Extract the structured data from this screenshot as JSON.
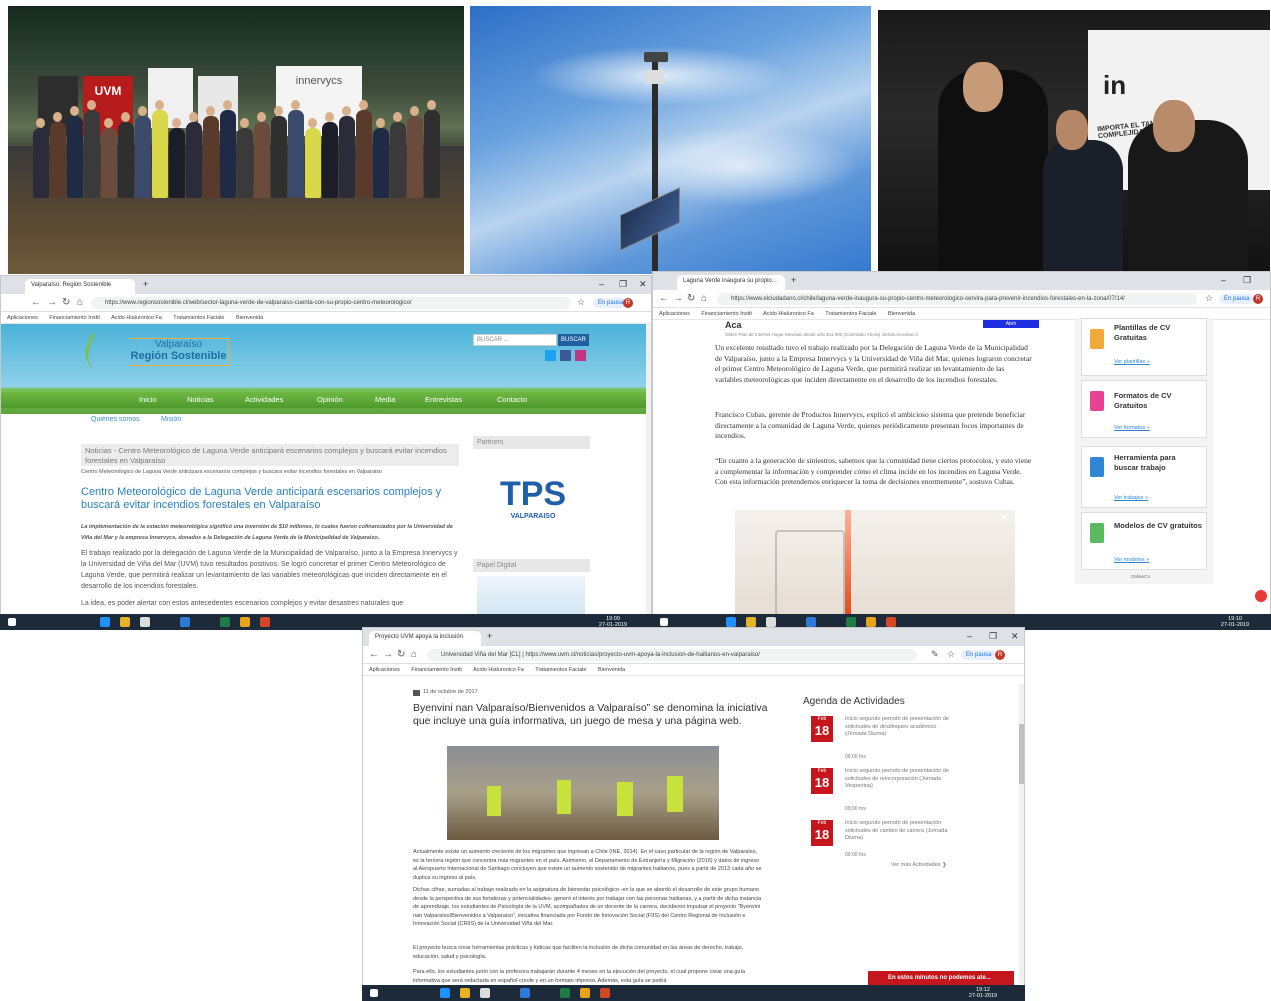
{
  "winA": {
    "tab": "Valparaíso: Región Sostenible",
    "url": "https://www.regionsostenible.cl/web/sector-laguna-verde-de-valparaiso-cuenta-con-su-propio-centro-meteorologico/",
    "pausa": "En pausa",
    "avatar": "R",
    "bookmarks": [
      "Aplicaciones",
      "Financiamiento Instit",
      "Acido Hialuronico Fa",
      "Tratamientos Faciale",
      "Bienvenida"
    ],
    "logo_line1": "Valparaíso",
    "logo_line2": "Región Sostenible",
    "search_placeholder": "BUSCAR ...",
    "search_button": "BUSCAR",
    "menu": [
      "Inicio",
      "Noticias",
      "Actividades",
      "Opinión",
      "Media",
      "Entrevistas",
      "Contacto"
    ],
    "submenu": [
      "Quiénes somos",
      "Misión"
    ],
    "breadcrumb": "Noticias - Centro Meteorológico de Laguna Verde anticipará escenarios complejos y buscará evitar incendios forestales en Valparaíso",
    "img_alt": "Centro Meteorologico de Laguna Verde anticipara escenarios complejos y buscara evitar incendios forestales en Valparaiso",
    "headline": "Centro Meteorológico de Laguna Verde anticipará escenarios complejos y buscará evitar incendios forestales en Valparaíso",
    "lead": "La implementación de la estación meteorológica significó una inversión de $10 millones, lo cuales fueron cofinanciados por la Universidad de Viña del Mar y la empresa Innervycs, donados a la Delegación de Laguna Verde de la Municipalidad de Valparaíso.",
    "body1": "El trabajo realizado por la delegación de Laguna Verde de la Municipalidad de Valparaíso, junto a la Empresa Innervycs y la Universidad de Viña del Mar (UVM) tuvo resultados positivos. Se logró concretar el primer Centro Meteorológico de Laguna Verde, que permitirá realizar un levantamiento de las variables meteorológicas que inciden directamente en el desarrollo de los incendios forestales.",
    "body2": "La idea, es poder alertar con estos antecedentes escenarios complejos y evitar desastres naturales que",
    "partners": "Partners",
    "tps": "TPS",
    "tps_sub": "VALPARAÍSO",
    "papel": "Papel Digital",
    "time": "19:09",
    "date": "27-01-2019"
  },
  "winB": {
    "tab": "Laguna Verde inaugura su propio...",
    "url": "https://www.elciudadano.cl/chile/laguna-verde-inaugura-su-propio-centro-meteorologico-servira-para-prevenir-incendios-forestales-en-la-zona/07/14/",
    "pausa": "En pausa",
    "avatar": "R",
    "bookmarks": [
      "Aplicaciones",
      "Financiamiento Instit",
      "Acido Hialuronico Fa",
      "Tratamientos Faciale",
      "Bienvenida"
    ],
    "ad_title": "Aca",
    "ad_text": "Obtén Plan de Internet Hogar Movistar desde sólo $11.990 (Contrátalo Ahora) ofertas.movistar.cl",
    "ad_button": "Abrir",
    "para1": "Un excelente resultado tuvo el trabajo realizado por la Delegación de Laguna Verde de la Municipalidad de Valparaíso, junto a la Empresa Innervycs y la Universidad de Viña del Mar, quienes lograron concretar el primer Centro Meteorológico de Laguna Verde, que permitirá realizar un levantamiento de las variables meteorológicas que inciden directamente en el desarrollo de los incendios forestales.",
    "para2": "Francisco Cubas, gerente de Productos Innervycs, explicó el ambicioso sistema que pretende beneficiar directamente a la comunidad de Laguna Verde, quienes periódicamente presentan focos importantes de incendios.",
    "para3": "“En cuanto a la generación de siniestros, sabemos que la comunidad tiene ciertos protocolos, y esto viene a complementar la información y comprender cómo el clima incide en los incendios en Laguna Verde. Con esta información pretendemos enriquecer la toma de decisiones enormemente”, sostuvo Cubas.",
    "cv": [
      {
        "title": "Plantillas de CV Gratuitas",
        "link": "Ver plantillas »",
        "color": "#f0a93b"
      },
      {
        "title": "Formatos de CV Gratuitos",
        "link": "Ver formatos »",
        "color": "#e84393"
      },
      {
        "title": "Herramienta para buscar trabajo",
        "link": "Ver trabajos »",
        "color": "#2f86d6"
      },
      {
        "title": "Modelos de CV gratuitos",
        "link": "Ver modelos »",
        "color": "#5cb85c"
      }
    ],
    "cv_footer": "OnlineCV",
    "time": "19:10",
    "date": "27-01-2019"
  },
  "winC": {
    "tab": "Proyecto UVM apoya la inclusión",
    "site": "Universidad Viña del Mar [CL]",
    "url": "https://www.uvm.cl/noticias/proyecto-uvm-apoya-la-inclusion-de-haitianos-en-valparaiso/",
    "pausa": "En pausa",
    "avatar": "R",
    "bookmarks": [
      "Aplicaciones",
      "Financiamiento Instit",
      "Acido Hialuronico Fa",
      "Tratamientos Faciale",
      "Bienvenida"
    ],
    "date_line": "11 de octubre de 2017",
    "headline": "Byenvini nan Valparaíso/Bienvenidos a Valparaíso” se denomina la iniciativa que incluye una guía informativa, un juego de mesa y una página web.",
    "p1": "Actualmente existe un aumento creciente de los migrantes que ingresan a Chile (INE, 2014). En el caso particular de la región de Valparaíso, es la tercera región que concentra más migrantes en el país. Asimismo, el Departamento de Extranjería y Migración (2016) y datos de ingreso al Aeropuerto Internacional de Santiago concluyen que existe un aumento sostenido de migrantes haitianos, pues a partir de 2013 cada año se duplica su ingreso al país.",
    "p2": "Dichas cifras, sumadas al trabajo realizado en la asignatura de bienestar psicológico -en la que se abordó el desarrollo de este grupo humano desde la perspectiva de sus fortalezas y potencialidades- generó el interés por trabajar con las personas haitianas, y a partir de dicha instancia de aprendizaje, los estudiantes de Psicología de la UVM, acompañados de un docente de la carrera, decidieron impulsar el proyecto “Byenvini nan Valparaíso/Bienvenidos a Valparaíso”, iniciativa financiada por Fondo de Innovación Social (FIIS) del Centro Regional de Inclusión e Innovación Social (CRIIS) de la Universidad Viña del Mar.",
    "p3": "El proyecto busca crear herramientas prácticas y lúdicas que faciliten la inclusión de dicha comunidad en las áreas de derecho, trabajo, educación, salud y psicología.",
    "p4": "Para ello, los estudiantes junto con la profesora trabajarán durante 4 meses en la ejecución del proyecto, el cual propone crear una guía informativa que será redactada en español-creole y en un formato impreso. Además, esta guía se podrá",
    "agenda_title": "Agenda de Actividades",
    "events": [
      {
        "month": "Feb",
        "day": "18",
        "text": "Inicio segundo período de presentación de solicitudes de desbloqueo académico (Jornada Diurna)",
        "time": "09:00 hrs"
      },
      {
        "month": "Feb",
        "day": "18",
        "text": "Inicio segundo período de presentación de solicitudes de reincorporación (Jornada Vespertina)",
        "time": "09:00 hrs"
      },
      {
        "month": "Feb",
        "day": "18",
        "text": "Inicio segundo período de presentación solicitudes de cambio de carrera (Jornada Diurna)",
        "time": "09:00 hrs"
      }
    ],
    "more": "Ver más Actividades",
    "chat": "En estos minutos no podemos ate...",
    "time": "19:12",
    "date": "27-01-2019"
  },
  "photo1": {
    "banner1": "UVM",
    "banner2": "innervycs"
  },
  "photo3": {
    "banner": "in",
    "slogan": "IMPORTA EL TAMAÑ LA COMPLEJIDAD DEL DESAFÍ"
  }
}
